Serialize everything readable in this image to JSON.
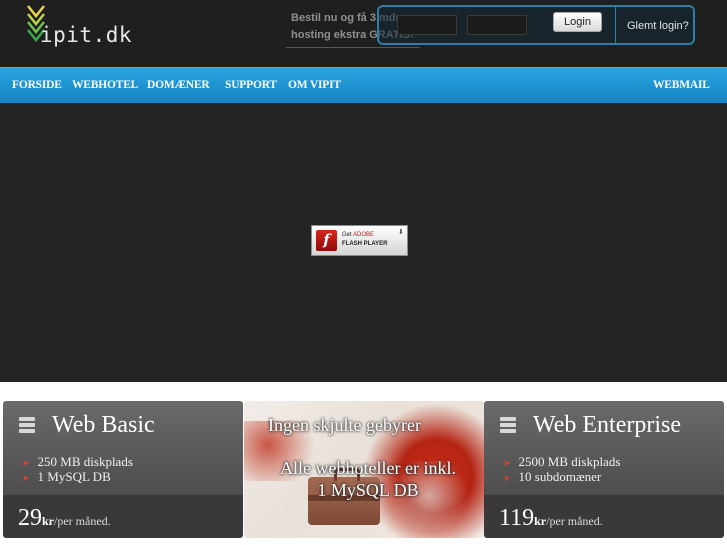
{
  "header": {
    "logo_text": "ipit.dk",
    "logo_mark": "V",
    "promo_line1": "Bestil nu og få 3 mdr.",
    "promo_line2": "hosting ekstra GRATIS!",
    "login_button": "Login",
    "forgot_link": "Glemt login?"
  },
  "nav": {
    "items": [
      {
        "label": "FORSIDE"
      },
      {
        "label": "WEBHOTEL"
      },
      {
        "label": "DOMÆNER"
      },
      {
        "label": "SUPPORT"
      },
      {
        "label": "OM VIPIT"
      }
    ],
    "webmail": "WEBMAIL"
  },
  "flash": {
    "get": "Get",
    "adobe": "ADOBE",
    "player": "FLASH PLAYER",
    "icon": "flash-player-icon"
  },
  "cards": {
    "basic": {
      "title": "Web Basic",
      "features": [
        "250 MB diskplads",
        "1 MySQL DB"
      ],
      "price": "29",
      "currency": "kr",
      "period": "/per måned."
    },
    "promo": {
      "title": "Ingen skjulte gebyrer",
      "subtitle_line1": "Alle webhoteller er inkl.",
      "subtitle_line2": "1 MySQL DB"
    },
    "enterprise": {
      "title": "Web Enterprise",
      "features": [
        "2500 MB diskplads",
        "10 subdomæner"
      ],
      "price": "119",
      "currency": "kr",
      "period": "/per måned."
    }
  },
  "colors": {
    "header_bg": "#1f1f1f",
    "nav_bg": "#1e94d3",
    "flash_bg": "#232323",
    "card_bg": "#5a5a5a",
    "accent_arrow": "#d9442a"
  }
}
